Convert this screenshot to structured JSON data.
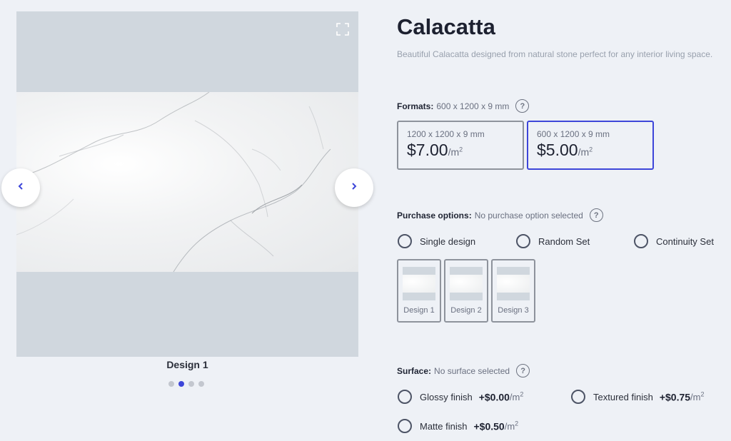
{
  "product": {
    "title": "Calacatta",
    "description": "Beautiful Calacatta designed from natural stone perfect for any interior living space."
  },
  "gallery": {
    "caption": "Design 1",
    "dots_count": 4,
    "active_dot": 1,
    "expand_icon": "expand-icon",
    "prev_icon": "chevron-left-icon",
    "next_icon": "chevron-right-icon"
  },
  "formats": {
    "label": "Formats:",
    "selected_text": "600 x 1200 x 9 mm",
    "help": "?",
    "options": [
      {
        "size": "1200 x 1200 x 9 mm",
        "price": "$7.00",
        "unit": "/m",
        "unit_exp": "2",
        "selected": false
      },
      {
        "size": "600 x 1200 x 9 mm",
        "price": "$5.00",
        "unit": "/m",
        "unit_exp": "2",
        "selected": true
      }
    ]
  },
  "purchase": {
    "label": "Purchase options:",
    "status": "No purchase option selected",
    "help": "?",
    "options": [
      "Single design",
      "Random Set",
      "Continuity Set"
    ],
    "designs": [
      "Design 1",
      "Design 2",
      "Design 3"
    ]
  },
  "surface": {
    "label": "Surface:",
    "status": "No surface selected",
    "help": "?",
    "options": [
      {
        "name": "Glossy finish",
        "price": "+$0.00",
        "unit": "/m",
        "unit_exp": "2"
      },
      {
        "name": "Textured finish",
        "price": "+$0.75",
        "unit": "/m",
        "unit_exp": "2"
      },
      {
        "name": "Matte finish",
        "price": "+$0.50",
        "unit": "/m",
        "unit_exp": "2"
      }
    ]
  },
  "colors": {
    "accent": "#3d46d9",
    "background": "#eef1f6",
    "gallery_bg": "#d0d7de"
  }
}
